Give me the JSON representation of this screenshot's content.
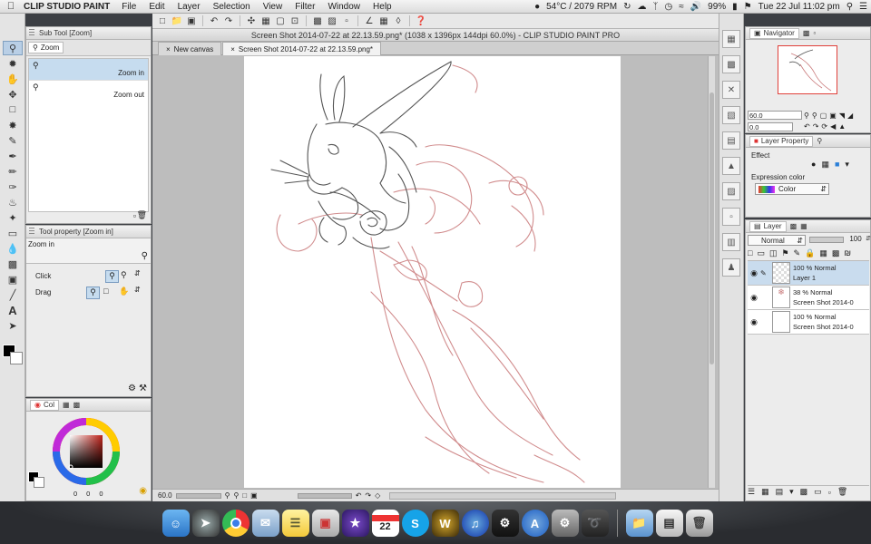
{
  "menubar": {
    "app_name": "CLIP STUDIO PAINT",
    "items": [
      "File",
      "Edit",
      "Layer",
      "Selection",
      "View",
      "Filter",
      "Window",
      "Help"
    ],
    "status_temp": "54°C / 2079 RPM",
    "battery": "99%",
    "clock": "Tue 22 Jul  11:02 pm"
  },
  "subtool_panel": {
    "title": "Sub Tool [Zoom]",
    "tab_label": "Zoom",
    "items": [
      "Zoom in",
      "Zoom out"
    ]
  },
  "tool_property": {
    "title": "Tool property [Zoom in]",
    "name": "Zoom in",
    "rows": [
      {
        "label": "Click"
      },
      {
        "label": "Drag"
      }
    ]
  },
  "color_panel": {
    "tab_label": "Col",
    "values": [
      "0",
      "0",
      "0"
    ]
  },
  "document": {
    "title": "Screen Shot 2014-07-22 at 22.13.59.png* (1038 x 1396px 144dpi 60.0%) - CLIP STUDIO PAINT PRO",
    "tabs": [
      "New canvas",
      "Screen Shot 2014-07-22 at 22.13.59.png*"
    ],
    "zoom": "60.0"
  },
  "navigator": {
    "title": "Navigator",
    "zoom_value": "60.0",
    "rotate_value": "0.0"
  },
  "layer_property": {
    "title": "Layer Property",
    "effect_label": "Effect",
    "expression_color_label": "Expression color",
    "color_mode": "Color"
  },
  "layer_panel": {
    "title": "Layer",
    "blend_mode": "Normal",
    "opacity": "100",
    "layers": [
      {
        "line1": "100 % Normal",
        "line2": "Layer 1",
        "selected": true
      },
      {
        "line1": "38 % Normal",
        "line2": "Screen Shot 2014-0",
        "selected": false
      },
      {
        "line1": "100 % Normal",
        "line2": "Screen Shot 2014-0",
        "selected": false
      }
    ]
  },
  "dock": {
    "calendar_day": "22"
  },
  "colors": {
    "sketch_red": "#c9797a",
    "sketch_dark": "#555555",
    "selection_blue": "#c6dcef",
    "navigator_frame": "#e0403a"
  }
}
